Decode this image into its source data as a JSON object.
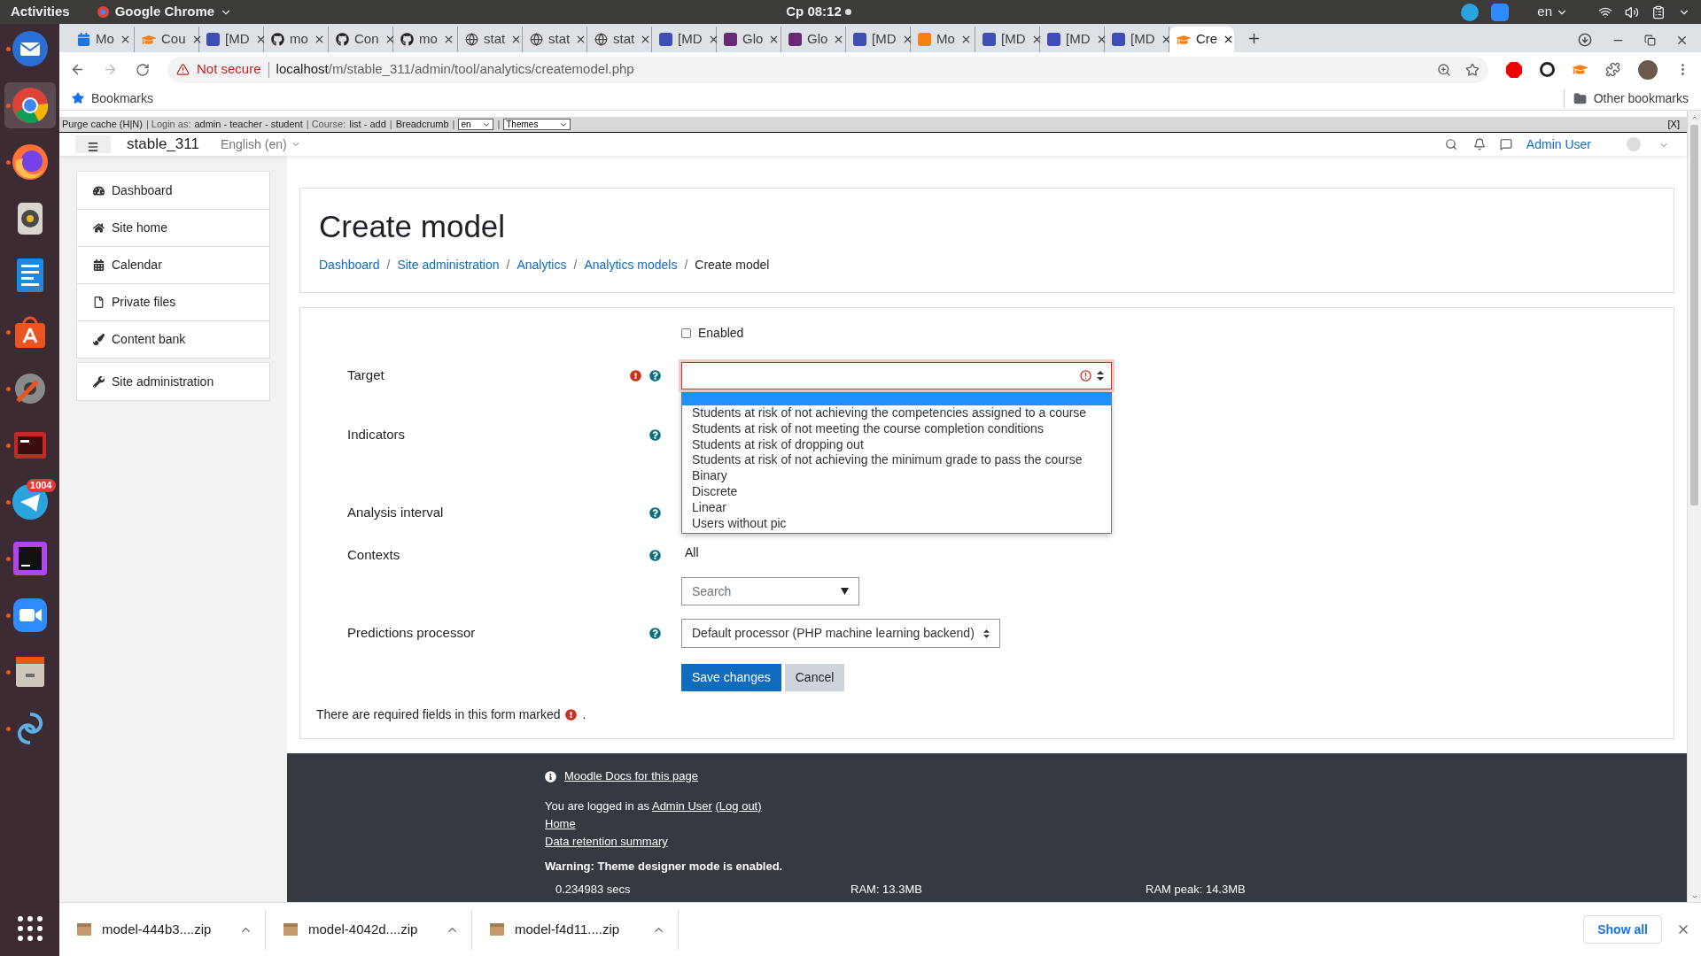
{
  "top_bar": {
    "activities": "Activities",
    "app": "Google Chrome",
    "clock": "Ср 08:12",
    "language": "en"
  },
  "dock": {
    "apps": [
      {
        "kind": "mail",
        "running": true,
        "selected": false
      },
      {
        "kind": "browser",
        "running": true,
        "selected": true
      },
      {
        "kind": "firefox",
        "running": true,
        "selected": false
      },
      {
        "kind": "speaker",
        "running": false,
        "selected": false
      },
      {
        "kind": "writer",
        "running": false,
        "selected": false
      },
      {
        "kind": "store",
        "running": true,
        "selected": false
      },
      {
        "kind": "tools",
        "running": true,
        "selected": false
      },
      {
        "kind": "terminal",
        "running": true,
        "selected": false
      },
      {
        "kind": "telegram",
        "running": true,
        "selected": false,
        "badge": "1004"
      },
      {
        "kind": "ide",
        "running": true,
        "selected": false
      },
      {
        "kind": "video",
        "running": true,
        "selected": false
      },
      {
        "kind": "files",
        "running": true,
        "selected": false
      },
      {
        "kind": "spiral",
        "running": true,
        "selected": false
      }
    ]
  },
  "tabs": [
    {
      "kind": "calendar",
      "label": "Mo",
      "selected": false
    },
    {
      "kind": "hat",
      "label": "Cou",
      "selected": false
    },
    {
      "kind": "blue",
      "label": "[MD",
      "selected": false
    },
    {
      "kind": "github",
      "label": "mo",
      "selected": false
    },
    {
      "kind": "github",
      "label": "Con",
      "selected": false
    },
    {
      "kind": "github",
      "label": "mo",
      "selected": false
    },
    {
      "kind": "globe",
      "label": "stat",
      "selected": false
    },
    {
      "kind": "globe",
      "label": "stat",
      "selected": false
    },
    {
      "kind": "globe",
      "label": "stat",
      "selected": false
    },
    {
      "kind": "blue",
      "label": "[MD",
      "selected": false
    },
    {
      "kind": "purple",
      "label": "Glo",
      "selected": false
    },
    {
      "kind": "purple",
      "label": "Glo",
      "selected": false
    },
    {
      "kind": "blue",
      "label": "[MD",
      "selected": false
    },
    {
      "kind": "orange",
      "label": "Mo",
      "selected": false
    },
    {
      "kind": "blue",
      "label": "[MD",
      "selected": false
    },
    {
      "kind": "blue",
      "label": "[MD",
      "selected": false
    },
    {
      "kind": "blue",
      "label": "[MD",
      "selected": false
    },
    {
      "kind": "hat",
      "label": "Cre",
      "selected": true
    }
  ],
  "address_bar": {
    "warning": "Not secure",
    "host": "localhost",
    "path": "/m/stable_311/admin/tool/analytics/createmodel.php"
  },
  "bookmarks": {
    "label": "Bookmarks",
    "other": "Other bookmarks"
  },
  "purge_bar": {
    "items": [
      {
        "kind": "link",
        "text": "Purge cache (H|N)"
      },
      {
        "kind": "text",
        "text": "| Login as:"
      },
      {
        "kind": "link",
        "text": "admin - teacher - student"
      },
      {
        "kind": "text",
        "text": "| Course:"
      },
      {
        "kind": "link",
        "text": "list - add"
      },
      {
        "kind": "text",
        "text": "|"
      },
      {
        "kind": "link",
        "text": "Breadcrumb"
      },
      {
        "kind": "text",
        "text": "|"
      },
      {
        "kind": "select",
        "text": "en"
      },
      {
        "kind": "text",
        "text": "|"
      },
      {
        "kind": "select",
        "text": "Themes"
      }
    ],
    "close": "[X]"
  },
  "navbar": {
    "site": "stable_311",
    "language": "English (en)",
    "user": "Admin User"
  },
  "sidebar": {
    "groups": [
      [
        {
          "kind": "dashboard",
          "label": "Dashboard"
        },
        {
          "kind": "home",
          "label": "Site home"
        },
        {
          "kind": "calendar",
          "label": "Calendar"
        },
        {
          "kind": "file",
          "label": "Private files"
        },
        {
          "kind": "brush",
          "label": "Content bank"
        }
      ],
      [
        {
          "kind": "wrench",
          "label": "Site administration"
        }
      ]
    ]
  },
  "page": {
    "title": "Create model",
    "breadcrumb": [
      {
        "kind": "link",
        "label": "Dashboard"
      },
      {
        "kind": "separator",
        "label": "/"
      },
      {
        "kind": "link",
        "label": "Site administration"
      },
      {
        "kind": "separator",
        "label": "/"
      },
      {
        "kind": "link",
        "label": "Analytics"
      },
      {
        "kind": "separator",
        "label": "/"
      },
      {
        "kind": "link",
        "label": "Analytics models"
      },
      {
        "kind": "separator",
        "label": "/"
      },
      {
        "kind": "current",
        "label": "Create model"
      }
    ]
  },
  "form": {
    "enabled": {
      "label": "Enabled",
      "checked": false
    },
    "target": {
      "label": "Target",
      "required": true,
      "error": true,
      "expanded": true,
      "blank_highlighted": true,
      "options": [
        "Students at risk of not achieving the competencies assigned to a course",
        "Students at risk of not meeting the course completion conditions",
        "Students at risk of dropping out",
        "Students at risk of not achieving the minimum grade to pass the course",
        "Binary",
        "Discrete",
        "Linear",
        "Users without pic"
      ]
    },
    "indicators": {
      "label": "Indicators"
    },
    "analysis_interval": {
      "label": "Analysis interval"
    },
    "contexts": {
      "label": "Contexts",
      "value": "All",
      "placeholder": "Search"
    },
    "predictions_processor": {
      "label": "Predictions processor",
      "value": "Default processor (PHP machine learning backend)"
    },
    "buttons": [
      {
        "kind": "primary",
        "label": "Save changes"
      },
      {
        "kind": "secondary",
        "label": "Cancel"
      }
    ],
    "required_note": "There are required fields in this form marked",
    "required_note_end": "."
  },
  "footer": {
    "docs_link": "Moodle Docs for this page",
    "logged_in": "You are logged in as",
    "user": "Admin User",
    "logout": "(Log out)",
    "home": "Home",
    "retention": "Data retention summary",
    "warning": "Warning: Theme designer mode is enabled.",
    "stats": [
      "0.234983 secs",
      "RAM: 13.3MB",
      "RAM peak: 14.3MB"
    ]
  },
  "downloads": {
    "items": [
      "model-444b3....zip",
      "model-4042d....zip",
      "model-f4d11....zip"
    ],
    "show_all": "Show all"
  }
}
